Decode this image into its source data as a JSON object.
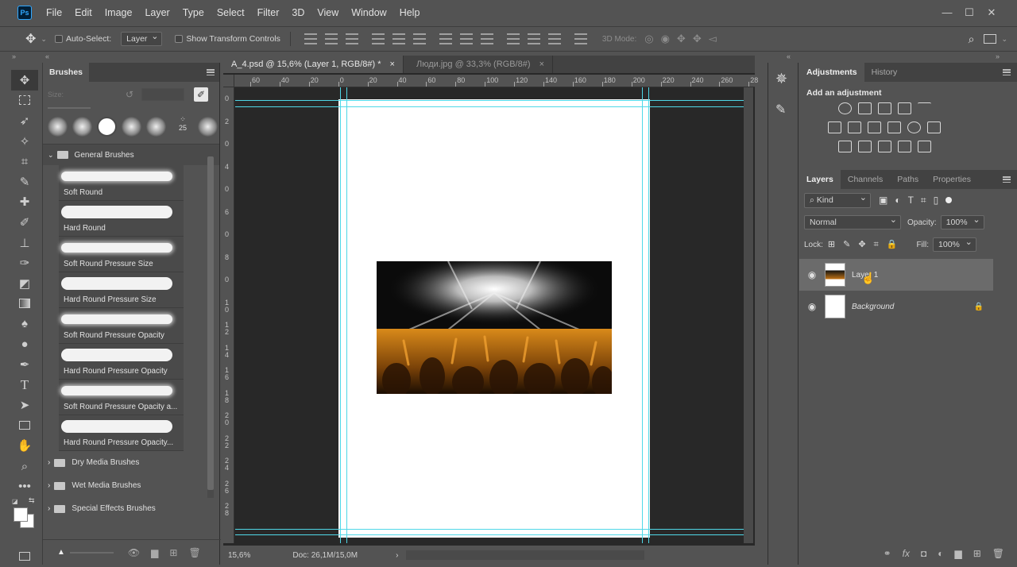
{
  "app": {
    "logo": "Ps"
  },
  "menu": [
    "File",
    "Edit",
    "Image",
    "Layer",
    "Type",
    "Select",
    "Filter",
    "3D",
    "View",
    "Window",
    "Help"
  ],
  "window_controls": {
    "minimize": "—",
    "maximize": "☐",
    "close": "✕"
  },
  "options_bar": {
    "auto_select_label": "Auto-Select:",
    "auto_select_value": "Layer",
    "show_transform_label": "Show Transform Controls",
    "mode_3d_label": "3D Mode:"
  },
  "brushes_panel": {
    "tab": "Brushes",
    "size_label": "Size:",
    "preset_number": "25",
    "group_name": "General Brushes",
    "brushes": [
      {
        "name": "Soft Round",
        "soft": true
      },
      {
        "name": "Hard Round",
        "soft": false
      },
      {
        "name": "Soft Round Pressure Size",
        "soft": true
      },
      {
        "name": "Hard Round Pressure Size",
        "soft": false
      },
      {
        "name": "Soft Round Pressure Opacity",
        "soft": true
      },
      {
        "name": "Hard Round Pressure Opacity",
        "soft": false
      },
      {
        "name": "Soft Round Pressure Opacity a...",
        "soft": true
      },
      {
        "name": "Hard Round Pressure Opacity...",
        "soft": false
      }
    ],
    "folders": [
      "Dry Media Brushes",
      "Wet Media Brushes",
      "Special Effects Brushes"
    ]
  },
  "document": {
    "tabs": [
      {
        "label": "A_4.psd @ 15,6% (Layer 1, RGB/8#) *",
        "close": "×",
        "active": true
      },
      {
        "label": "Люди.jpg @ 33,3% (RGB/8#)",
        "close": "×",
        "active": false
      }
    ],
    "h_ruler": [
      "60",
      "40",
      "20",
      "0",
      "20",
      "40",
      "60",
      "80",
      "100",
      "120",
      "140",
      "160",
      "180",
      "200",
      "220",
      "240",
      "260",
      "28"
    ],
    "v_ruler": [
      "0",
      "2",
      "0",
      "4",
      "0",
      "6",
      "0",
      "8",
      "0",
      "1 0",
      "1 2",
      "1 4",
      "1 6",
      "1 8",
      "2 0",
      "2 2",
      "2 4",
      "2 6",
      "2 8"
    ],
    "zoom": "15,6%",
    "doc_size": "Doc: 26,1M/15,0M"
  },
  "adjustments_panel": {
    "tabs": [
      "Adjustments",
      "History"
    ],
    "title": "Add an adjustment"
  },
  "layers_panel": {
    "tabs": [
      "Layers",
      "Channels",
      "Paths",
      "Properties"
    ],
    "kind_label": "Kind",
    "blend_mode": "Normal",
    "opacity_label": "Opacity:",
    "opacity_value": "100%",
    "lock_label": "Lock:",
    "fill_label": "Fill:",
    "fill_value": "100%",
    "layers": [
      {
        "name": "Layer 1",
        "visible": true,
        "selected": true
      },
      {
        "name": "Background",
        "visible": true,
        "selected": false,
        "locked": true
      }
    ]
  },
  "colors": {
    "accent": "#31a8ff",
    "guide": "#4fd8e8",
    "panel": "#535353",
    "canvas_bg": "#282828"
  }
}
